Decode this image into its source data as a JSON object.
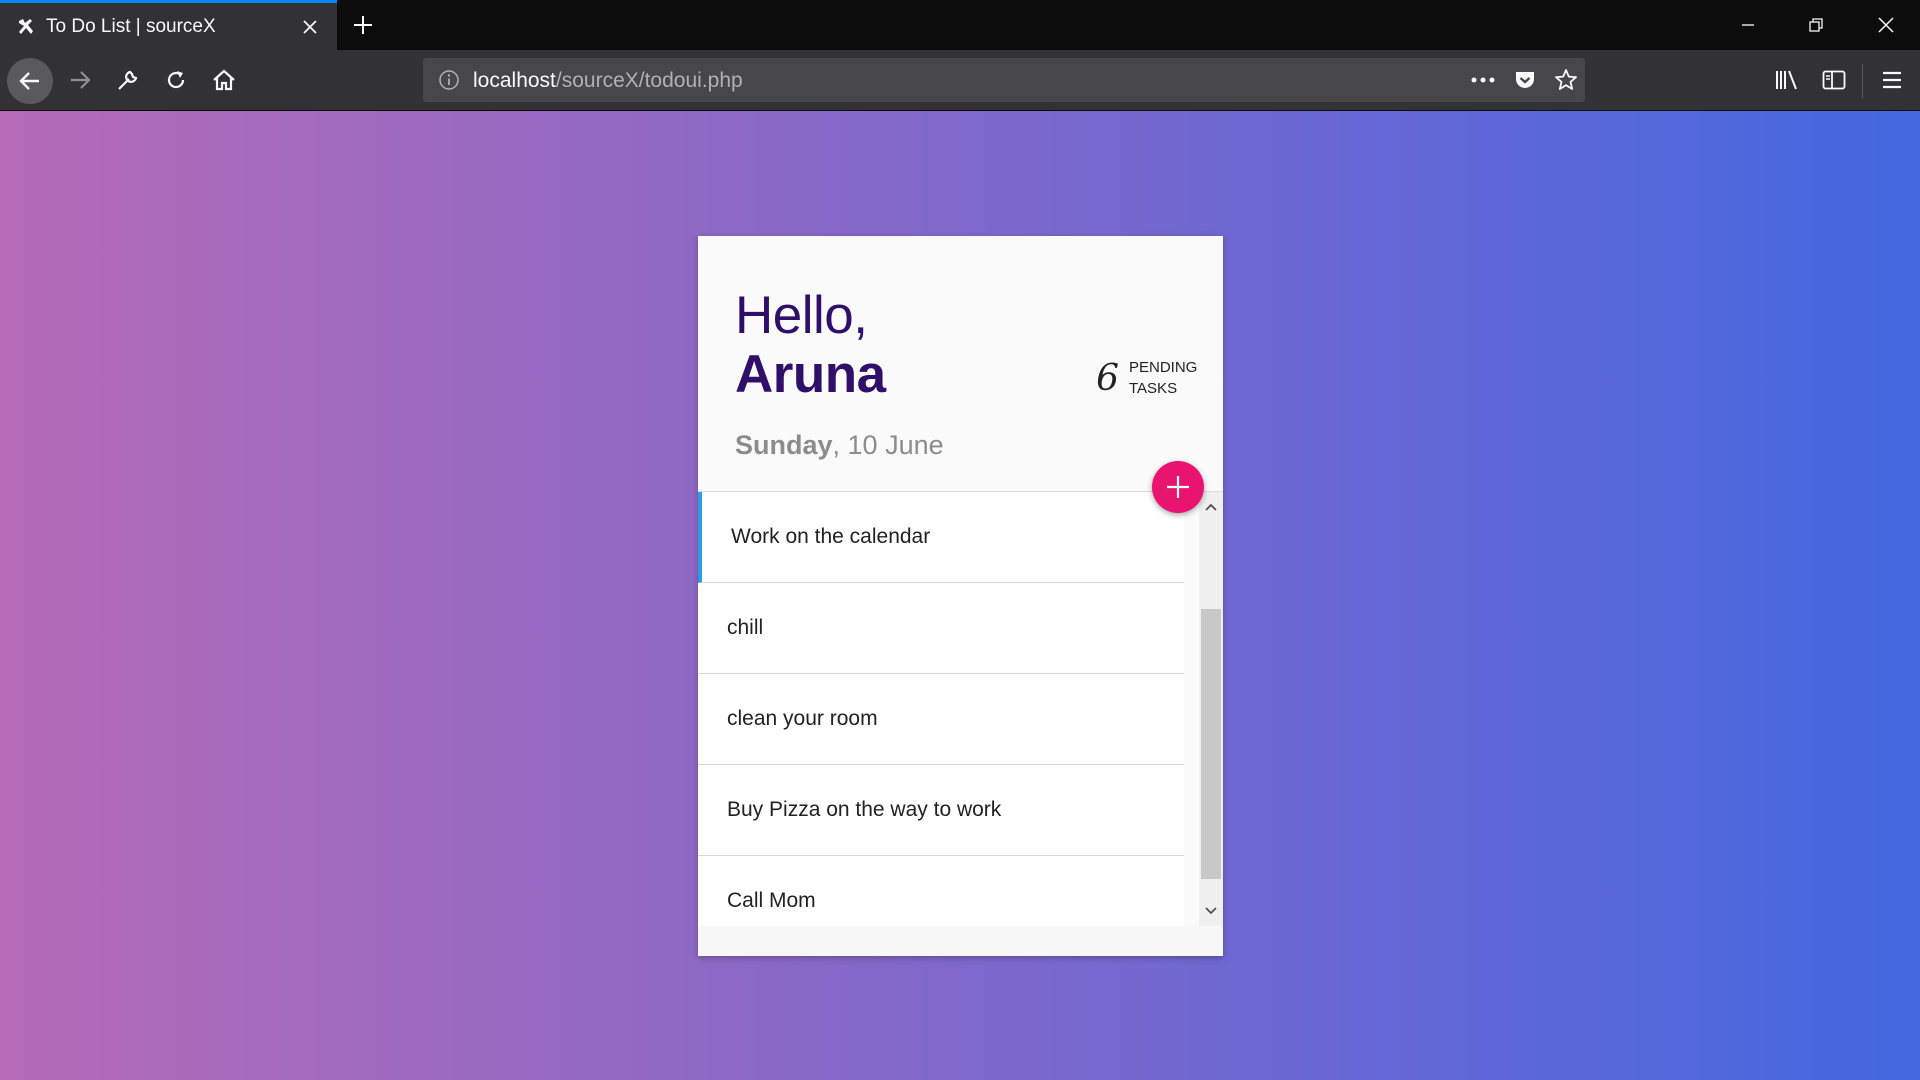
{
  "browser": {
    "tab": {
      "title": "To Do List | sourceX",
      "favicon": "tools-icon"
    },
    "url": {
      "host": "localhost",
      "path": "/sourceX/todoui.php"
    },
    "accent": "#0a84ff"
  },
  "app": {
    "greeting": {
      "hello": "Hello,",
      "name": "Aruna"
    },
    "pending": {
      "count": "6",
      "label": "PENDING TASKS"
    },
    "date": {
      "weekday": "Sunday",
      "rest": ", 10 June"
    },
    "add_icon": "plus-icon",
    "tasks": [
      {
        "label": "Work on the calendar",
        "active": true
      },
      {
        "label": "chill"
      },
      {
        "label": "clean your room"
      },
      {
        "label": "Buy Pizza on the way to work"
      },
      {
        "label": "Call Mom"
      }
    ],
    "colors": {
      "title": "#2f0f69",
      "add_button": "#e8146f",
      "active_marker": "#2b9de6",
      "gradient_left": "#b46ab7",
      "gradient_right": "#4468e0"
    }
  }
}
